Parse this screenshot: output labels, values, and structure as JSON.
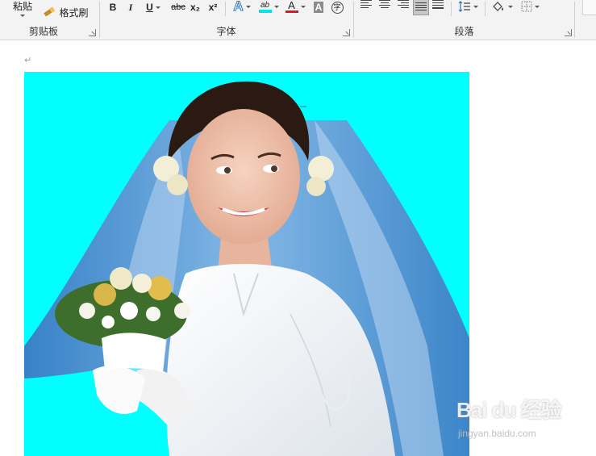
{
  "ribbon": {
    "clipboard": {
      "paste_label": "粘贴",
      "format_painter_label": "格式刷",
      "group_label": "剪贴板"
    },
    "font": {
      "bold": "B",
      "italic": "I",
      "underline": "U",
      "strikethrough": "abc",
      "subscript": "x₂",
      "superscript": "x²",
      "text_effect": "A",
      "highlight": "ab",
      "font_color": "A",
      "char_shading": "A",
      "enclose_char": "字",
      "group_label": "字体",
      "highlight_color": "#00e5e5",
      "font_color_value": "#e81123"
    },
    "paragraph": {
      "group_label": "段落"
    }
  },
  "document": {
    "paragraph_mark": "↵",
    "image_background": "#00ffff",
    "image_icon": "bride-photo"
  },
  "watermark": {
    "brand": "Bai du 经验",
    "url": "jingyan.baidu.com"
  }
}
